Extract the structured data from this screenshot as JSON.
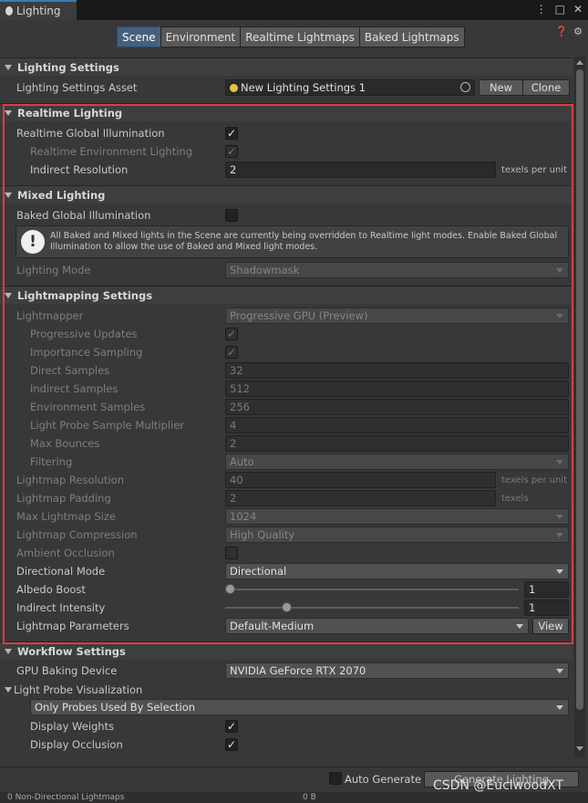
{
  "window": {
    "tab_title": "Lighting"
  },
  "toolbar": {
    "tabs": [
      "Scene",
      "Environment",
      "Realtime Lightmaps",
      "Baked Lightmaps"
    ],
    "active_tab": "Scene"
  },
  "lighting_settings": {
    "header": "Lighting Settings",
    "asset_label": "Lighting Settings Asset",
    "asset_value": "New Lighting Settings 1",
    "new_label": "New",
    "clone_label": "Clone"
  },
  "realtime": {
    "header": "Realtime Lighting",
    "gi_label": "Realtime Global Illumination",
    "gi_checked": true,
    "env_label": "Realtime Environment Lighting",
    "env_checked": true,
    "indirect_label": "Indirect Resolution",
    "indirect_value": "2",
    "indirect_unit": "texels per unit"
  },
  "mixed": {
    "header": "Mixed Lighting",
    "baked_gi_label": "Baked Global Illumination",
    "baked_gi_checked": false,
    "warning": "All Baked and Mixed lights in the Scene are currently being overridden to Realtime light modes. Enable Baked Global Illumination to allow the use of Baked and Mixed light modes.",
    "mode_label": "Lighting Mode",
    "mode_value": "Shadowmask"
  },
  "lightmapping": {
    "header": "Lightmapping Settings",
    "lightmapper_label": "Lightmapper",
    "lightmapper_value": "Progressive GPU (Preview)",
    "progressive_label": "Progressive Updates",
    "importance_label": "Importance Sampling",
    "direct_label": "Direct Samples",
    "direct_value": "32",
    "indirect_label": "Indirect Samples",
    "indirect_value": "512",
    "env_label": "Environment Samples",
    "env_value": "256",
    "probe_mult_label": "Light Probe Sample Multiplier",
    "probe_mult_value": "4",
    "bounces_label": "Max Bounces",
    "bounces_value": "2",
    "filtering_label": "Filtering",
    "filtering_value": "Auto",
    "resolution_label": "Lightmap Resolution",
    "resolution_value": "40",
    "resolution_unit": "texels per unit",
    "padding_label": "Lightmap Padding",
    "padding_value": "2",
    "padding_unit": "texels",
    "max_size_label": "Max Lightmap Size",
    "max_size_value": "1024",
    "compression_label": "Lightmap Compression",
    "compression_value": "High Quality",
    "ao_label": "Ambient Occlusion",
    "directional_label": "Directional Mode",
    "directional_value": "Directional",
    "albedo_label": "Albedo Boost",
    "albedo_value": "1",
    "albedo_fraction": 0.0,
    "intensity_label": "Indirect Intensity",
    "intensity_value": "1",
    "intensity_fraction": 0.2,
    "params_label": "Lightmap Parameters",
    "params_value": "Default-Medium",
    "view_label": "View"
  },
  "workflow": {
    "header": "Workflow Settings",
    "gpu_label": "GPU Baking Device",
    "gpu_value": "NVIDIA GeForce RTX 2070",
    "probe_vis_label": "Light Probe Visualization",
    "probe_vis_value": "Only Probes Used By Selection",
    "weights_label": "Display Weights",
    "weights_checked": true,
    "occlusion_label": "Display Occlusion",
    "occlusion_checked": true
  },
  "footer": {
    "auto_label": "Auto Generate",
    "generate_label": "Generate Lighting",
    "status": "0 Non-Directional Lightmaps",
    "size": "0 B"
  },
  "watermark": "CSDN @EuclwoodXT"
}
